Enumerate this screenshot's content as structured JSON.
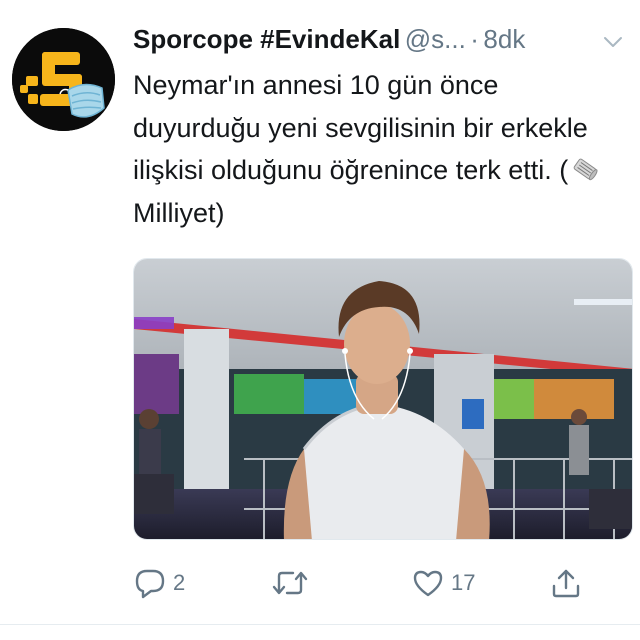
{
  "tweet": {
    "author_name": "Sporcope #EvindeKal",
    "handle": "@s...",
    "separator": "·",
    "time": "8dk",
    "text_before_emoji": "Neymar'ın annesi 10 gün önce duyurduğu yeni sevgilisinin bir erkekle ilişkisi olduğunu öğrenince terk etti. (",
    "text_after_emoji": " Milliyet)",
    "emoji": "rolled-newspaper-icon",
    "media_description_icon": "gym-photo",
    "actions": {
      "reply_count": "2",
      "retweet_count": "",
      "like_count": "17"
    }
  },
  "colors": {
    "accent_yellow": "#f7b51b",
    "text_primary": "#14171a",
    "text_secondary": "#657786"
  }
}
